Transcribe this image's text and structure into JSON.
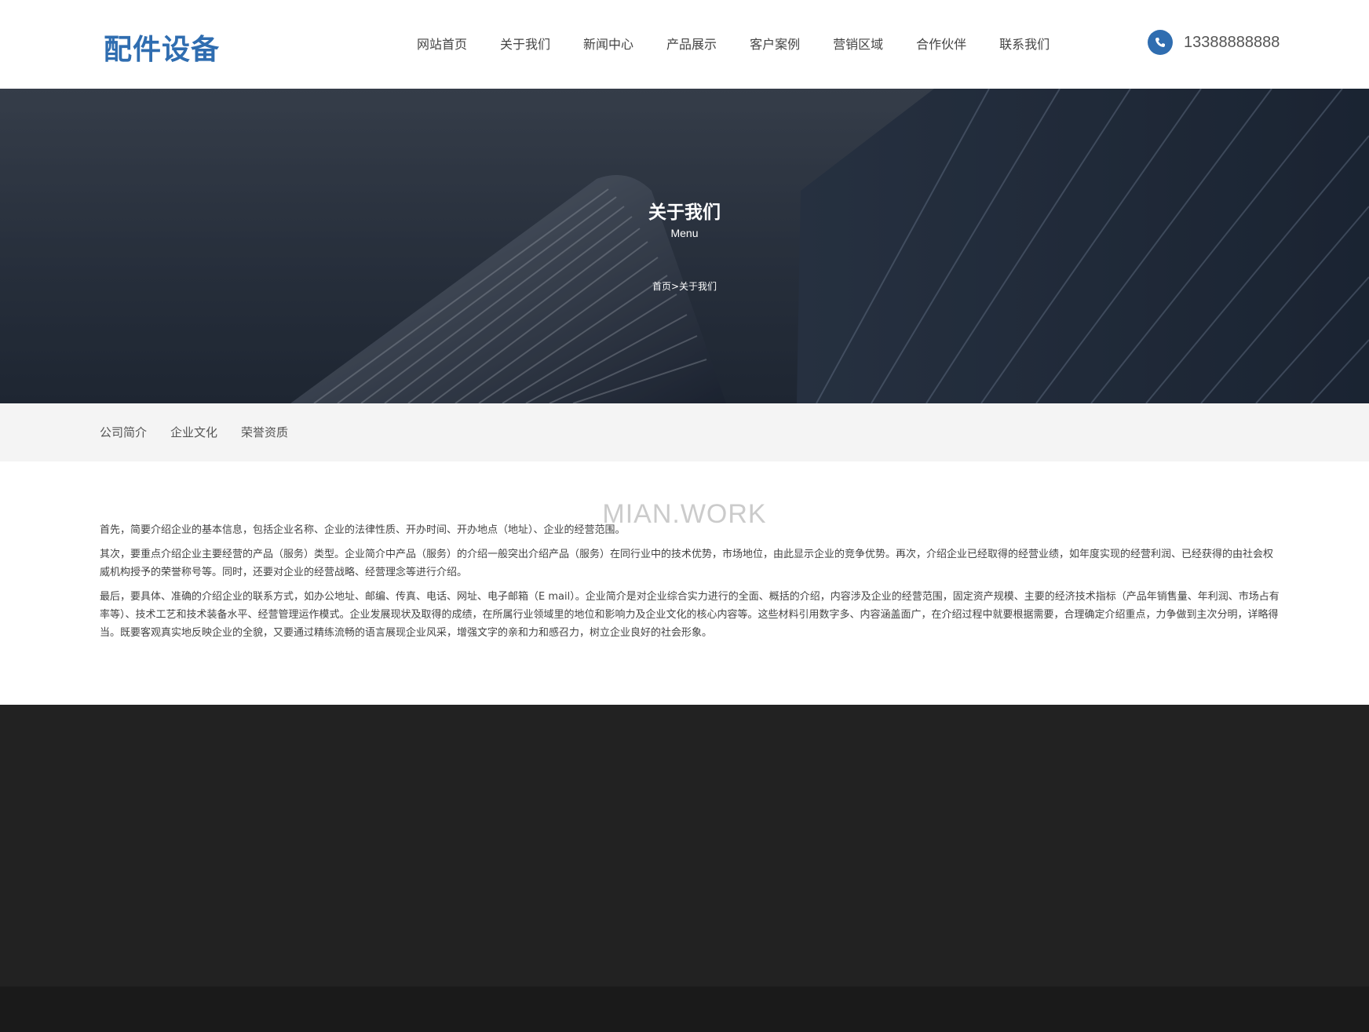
{
  "header": {
    "logo": "配件设备",
    "nav": [
      "网站首页",
      "关于我们",
      "新闻中心",
      "产品展示",
      "客户案例",
      "营销区域",
      "合作伙伴",
      "联系我们"
    ],
    "phone": "13388888888"
  },
  "banner": {
    "title": "关于我们",
    "subtitle": "Menu",
    "breadcrumb": {
      "home": "首页",
      "separator": ">",
      "current": "关于我们"
    }
  },
  "subnav": [
    "公司简介",
    "企业文化",
    "荣誉资质"
  ],
  "watermark": "MIAN.WORK",
  "content": {
    "paragraphs": [
      "首先，简要介绍企业的基本信息，包括企业名称、企业的法律性质、开办时间、开办地点（地址）、企业的经营范围。",
      "其次，要重点介绍企业主要经营的产品（服务）类型。企业简介中产品（服务）的介绍一般突出介绍产品（服务）在同行业中的技术优势，市场地位，由此显示企业的竞争优势。再次，介绍企业已经取得的经营业绩，如年度实现的经营利润、已经获得的由社会权威机构授予的荣誉称号等。同时，还要对企业的经营战略、经营理念等进行介绍。",
      "最后，要具体、准确的介绍企业的联系方式，如办公地址、邮编、传真、电话、网址、电子邮箱（E mail）。企业简介是对企业综合实力进行的全面、概括的介绍，内容涉及企业的经营范围，固定资产规模、主要的经济技术指标（产品年销售量、年利润、市场占有率等）、技术工艺和技术装备水平、经营管理运作模式。企业发展现状及取得的成绩，在所属行业领域里的地位和影响力及企业文化的核心内容等。这些材料引用数字多、内容涵盖面广，在介绍过程中就要根据需要，合理确定介绍重点，力争做到主次分明，详略得当。既要客观真实地反映企业的全貌，又要通过精练流畅的语言展现企业风采，增强文字的亲和力和感召力，树立企业良好的社会形象。"
    ]
  },
  "colors": {
    "brand": "#2f6db0",
    "footer": "#222222",
    "subnav_bg": "#f4f4f4"
  },
  "icons": {
    "phone": "phone-icon"
  }
}
